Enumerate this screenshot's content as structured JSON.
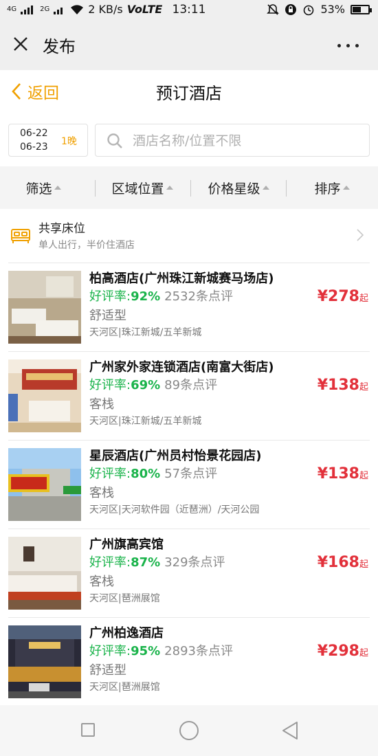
{
  "status_bar": {
    "signal1": "4G",
    "signal2": "2G",
    "speed": "2 KB/s",
    "volte": "VoLTE",
    "time": "13:11",
    "battery": "53%",
    "battery_level": 0.53
  },
  "wechat_header": {
    "title": "发布"
  },
  "page_header": {
    "back_label": "返回",
    "title": "预订酒店"
  },
  "search": {
    "check_in": "06-22",
    "check_out": "06-23",
    "nights": "1晚",
    "placeholder": "酒店名称/位置不限"
  },
  "filters": [
    {
      "label": "筛选"
    },
    {
      "label": "区域位置"
    },
    {
      "label": "价格星级"
    },
    {
      "label": "排序"
    }
  ],
  "share_bed": {
    "title": "共享床位",
    "subtitle": "单人出行，半价住酒店"
  },
  "hotels": [
    {
      "name": "柏高酒店(广州珠江新城赛马场店)",
      "rating_label": "好评率:",
      "rating": "92%",
      "reviews": "2532条点评",
      "type": "舒适型",
      "location": "天河区|珠江新城/五羊新城",
      "price": "¥278",
      "price_suffix": "起"
    },
    {
      "name": "广州家外家连锁酒店(南富大街店)",
      "rating_label": "好评率:",
      "rating": "69%",
      "reviews": "89条点评",
      "type": "客栈",
      "location": "天河区|珠江新城/五羊新城",
      "price": "¥138",
      "price_suffix": "起"
    },
    {
      "name": "星辰酒店(广州员村怡景花园店)",
      "rating_label": "好评率:",
      "rating": "80%",
      "reviews": "57条点评",
      "type": "客栈",
      "location": "天河区|天河软件园（近琶洲）/天河公园",
      "price": "¥138",
      "price_suffix": "起"
    },
    {
      "name": "广州旗高宾馆",
      "rating_label": "好评率:",
      "rating": "87%",
      "reviews": "329条点评",
      "type": "客栈",
      "location": "天河区|琶洲展馆",
      "price": "¥168",
      "price_suffix": "起"
    },
    {
      "name": "广州柏逸酒店",
      "rating_label": "好评率:",
      "rating": "95%",
      "reviews": "2893条点评",
      "type": "舒适型",
      "location": "天河区|琶洲展馆",
      "price": "¥298",
      "price_suffix": "起"
    }
  ],
  "colors": {
    "accent": "#f0a000",
    "price": "#e2303a",
    "rating": "#19b34a"
  },
  "icons": [
    "close-icon",
    "more-icon",
    "back-chevron-icon",
    "search-icon",
    "bed-icon",
    "chevron-right-icon",
    "nav-recents-icon",
    "nav-home-icon",
    "nav-back-icon"
  ]
}
